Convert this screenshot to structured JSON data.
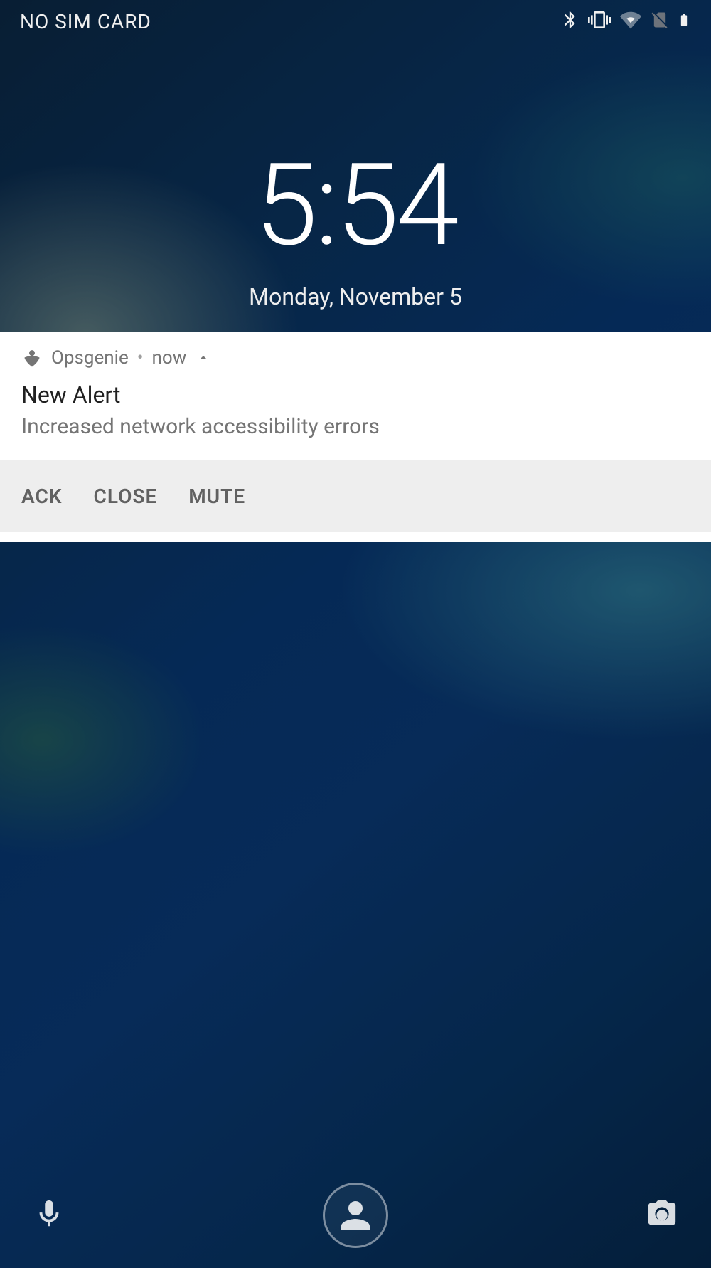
{
  "statusBar": {
    "carrier": "NO SIM CARD"
  },
  "clock": {
    "time": "5:54",
    "date": "Monday, November 5"
  },
  "notification": {
    "appName": "Opsgenie",
    "separator": "•",
    "timeLabel": "now",
    "title": "New Alert",
    "body": "Increased network accessibility errors",
    "actions": {
      "ack": "ACK",
      "close": "CLOSE",
      "mute": "MUTE"
    }
  }
}
